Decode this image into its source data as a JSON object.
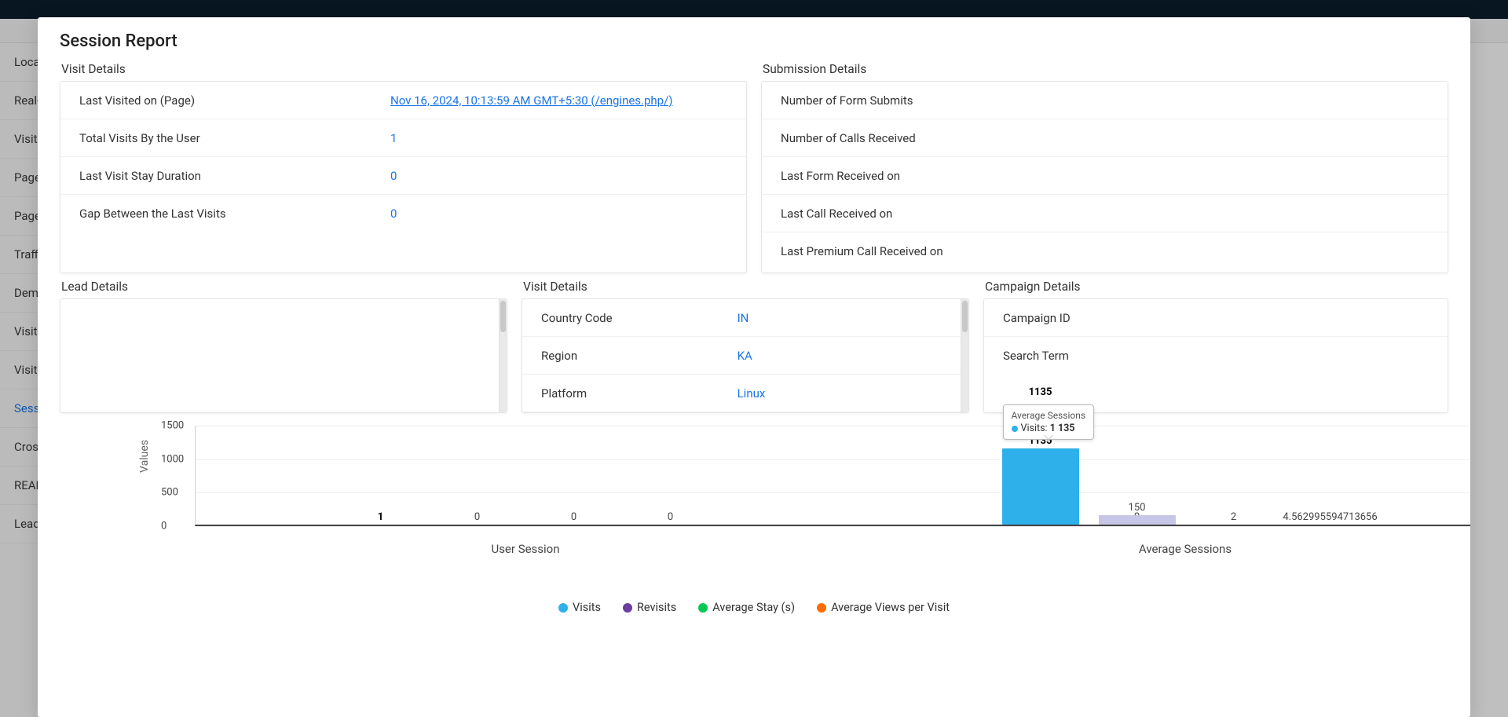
{
  "sidebar": {
    "items": [
      {
        "label": "Loca"
      },
      {
        "label": "Real-"
      },
      {
        "label": "Visit "
      },
      {
        "label": "Page"
      },
      {
        "label": "Page"
      },
      {
        "label": "Traffi"
      },
      {
        "label": "Dem"
      },
      {
        "label": "Visito"
      },
      {
        "label": "Visito"
      },
      {
        "label": "Sess",
        "active": true
      },
      {
        "label": "Cross"
      },
      {
        "label": "REAL"
      },
      {
        "label": "Lead"
      }
    ]
  },
  "modal": {
    "title": "Session Report"
  },
  "sections": {
    "visit_details_title": "Visit Details",
    "submission_details_title": "Submission Details",
    "lead_details_title": "Lead Details",
    "visit_details2_title": "Visit Details",
    "campaign_details_title": "Campaign Details"
  },
  "visit_details": {
    "last_visited_label": "Last Visited on (Page)",
    "last_visited_value": "Nov 16, 2024, 10:13:59 AM GMT+5:30 (/engines.php/)",
    "total_visits_label": "Total Visits By the User",
    "total_visits_value": "1",
    "stay_duration_label": "Last Visit Stay Duration",
    "stay_duration_value": "0",
    "gap_label": "Gap Between the Last Visits",
    "gap_value": "0"
  },
  "submission_details": {
    "form_submits_label": "Number of Form Submits",
    "calls_label": "Number of Calls Received",
    "last_form_label": "Last Form Received on",
    "last_call_label": "Last Call Received on",
    "last_premium_label": "Last Premium Call Received on"
  },
  "visit_details2": {
    "country_label": "Country Code",
    "country_value": "IN",
    "region_label": "Region",
    "region_value": "KA",
    "platform_label": "Platform",
    "platform_value": "Linux"
  },
  "campaign_details": {
    "campaign_id_label": "Campaign ID",
    "search_term_label": "Search Term"
  },
  "chart_data": {
    "type": "bar",
    "ylabel": "Values",
    "ylim": [
      0,
      1500
    ],
    "yticks": [
      0,
      500,
      1000,
      1500
    ],
    "categories": [
      "User Session",
      "Average Sessions"
    ],
    "series": [
      {
        "name": "Visits",
        "color": "#2eb0ea",
        "values": [
          1,
          1135
        ]
      },
      {
        "name": "Revisits",
        "color": "#6b3fa0",
        "values": [
          0,
          0
        ]
      },
      {
        "name": "Average Stay (s)",
        "color": "#00c853",
        "values": [
          0,
          2
        ]
      },
      {
        "name": "Average Views per Visit",
        "color": "#ff6d00",
        "values": [
          0,
          0
        ]
      }
    ],
    "extra_labels_average": {
      "views_label": "150",
      "rightmost_label": "4.562995594713656"
    },
    "tooltip": {
      "title": "Average Sessions",
      "series": "Visits",
      "value": "1 135",
      "value_label_above": "1135"
    },
    "legend": [
      "Visits",
      "Revisits",
      "Average Stay (s)",
      "Average Views per Visit"
    ]
  }
}
